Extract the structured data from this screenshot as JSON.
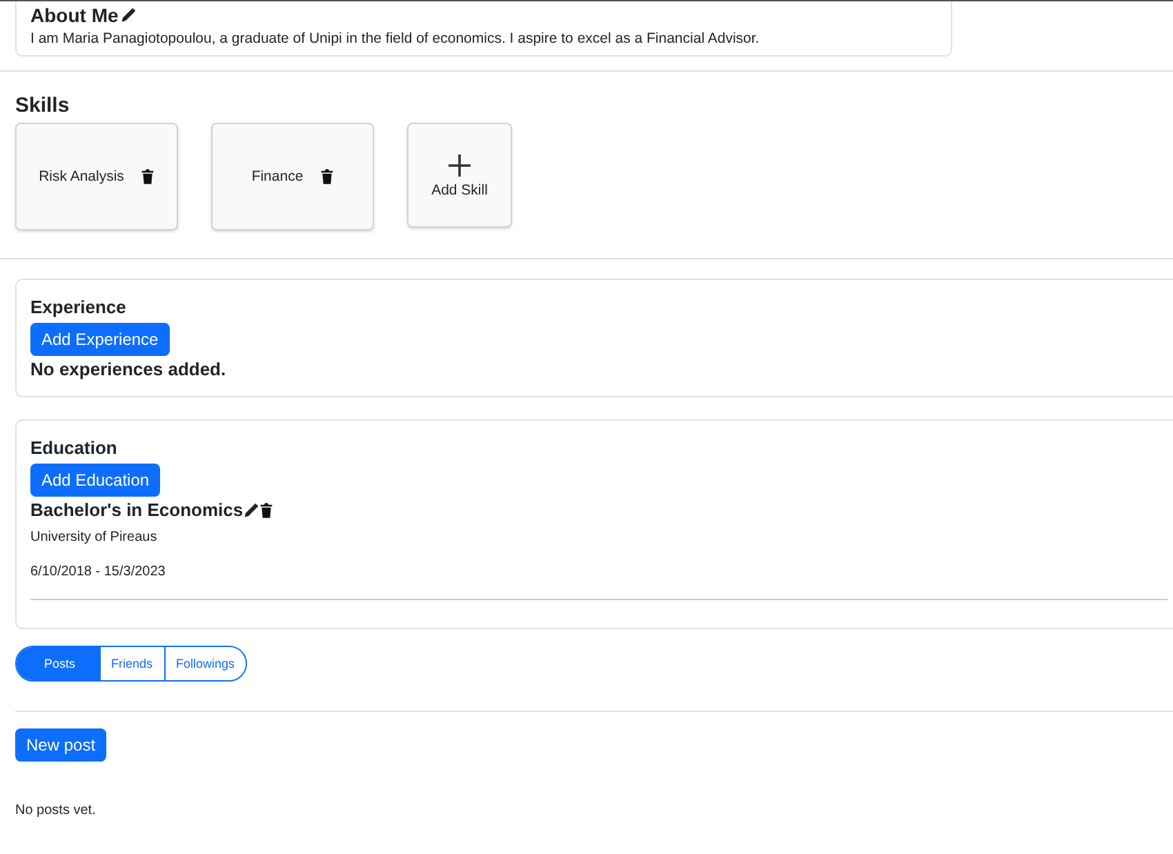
{
  "about": {
    "title": "About Me",
    "text": "I am Maria Panagiotopoulou, a graduate of Unipi in the field of economics. I aspire to excel as a Financial Advisor."
  },
  "skills": {
    "title": "Skills",
    "items": [
      {
        "name": "Risk Analysis"
      },
      {
        "name": "Finance"
      }
    ],
    "add_label": "Add Skill"
  },
  "experience": {
    "title": "Experience",
    "button": "Add Experience",
    "empty_text": "No experiences added."
  },
  "education": {
    "title": "Education",
    "button": "Add Education",
    "entries": [
      {
        "degree": "Bachelor's in Economics",
        "school": "University of Pireaus",
        "dates": "6/10/2018 - 15/3/2023"
      }
    ]
  },
  "tabs": [
    {
      "label": "Posts",
      "selected": true
    },
    {
      "label": "Friends",
      "selected": false
    },
    {
      "label": "Followings",
      "selected": false
    }
  ],
  "posts": {
    "button": "New post",
    "empty_text": "No posts vet."
  }
}
